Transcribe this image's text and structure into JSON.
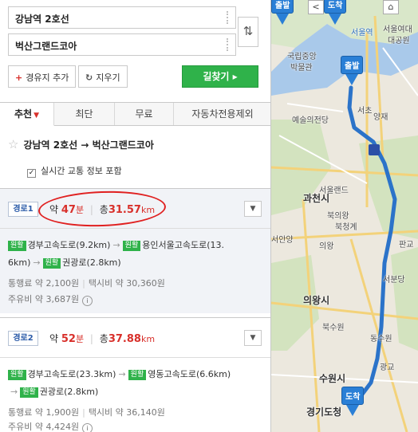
{
  "search": {
    "origin": "강남역 2호선",
    "destination": "벅산그랜드코아",
    "swap_icon": "⇅"
  },
  "buttons": {
    "add_waypoint": "경유지 추가",
    "add_icon": "+",
    "clear": "지우기",
    "clear_icon": "↻",
    "find_route": "길찾기 ▸"
  },
  "tabs": [
    {
      "label": "추천",
      "active": true
    },
    {
      "label": "최단",
      "active": false
    },
    {
      "label": "무료",
      "active": false
    },
    {
      "label": "자동차전용제외",
      "active": false
    }
  ],
  "route_header": {
    "title": "강남역 2호선 → 벅산그랜드코아",
    "star_icon": "☆",
    "traffic_label": "실시간 교통 정보 포함",
    "traffic_checked": true
  },
  "routes": [
    {
      "badge": "경로1",
      "time_prefix": "약",
      "time_value": "47",
      "time_unit": "분",
      "dist_prefix": "총",
      "dist_value": "31.57",
      "dist_unit": "km",
      "tag": "원활",
      "road1": "경부고속도로(9.2km)",
      "road2": "용인서울고속도로(13.",
      "road2_cont": "6km)",
      "road3": "권광로(2.8km)",
      "toll": "통행료 약 2,100원",
      "taxi": "택시비 약 30,360원",
      "fuel": "주유비 약 3,687원",
      "highlighted": true
    },
    {
      "badge": "경로2",
      "time_prefix": "약",
      "time_value": "52",
      "time_unit": "분",
      "dist_prefix": "총",
      "dist_value": "37.88",
      "dist_unit": "km",
      "tag": "원활",
      "road1": "경부고속도로(23.3km)",
      "road2": "영동고속도로(6.6km)",
      "road3": "권광로(2.8km)",
      "toll": "통행료 약 1,900원",
      "taxi": "택시비 약 36,140원",
      "fuel": "주유비 약 4,424원",
      "highlighted": false
    }
  ],
  "map": {
    "start_pin": "출발",
    "end_pin": "도착",
    "top_pin_start": "출발",
    "top_pin_end": "도착",
    "labels": {
      "seoul_station": "서울역",
      "seoul_univ": "서울여대",
      "daegong": "대공원",
      "museum1": "국립중앙",
      "museum2": "박물관",
      "seocho": "서초",
      "arts1": "예술의전당",
      "yangjae": "양재",
      "seoul_land": "서울랜드",
      "gwacheon": "과천시",
      "bokumjeong": "북의왕",
      "bukcheonggye": "북청계",
      "bukuiwang": "의왕",
      "anyang": "서안양",
      "uiwang": "의왕시",
      "dongsuwon": "동수원",
      "suwon_ic": "북수원",
      "gwanggyo": "광교",
      "suwon": "수원시",
      "gyeonggi": "경기도청",
      "seobundang": "서분당",
      "pangyo": "판교"
    }
  }
}
